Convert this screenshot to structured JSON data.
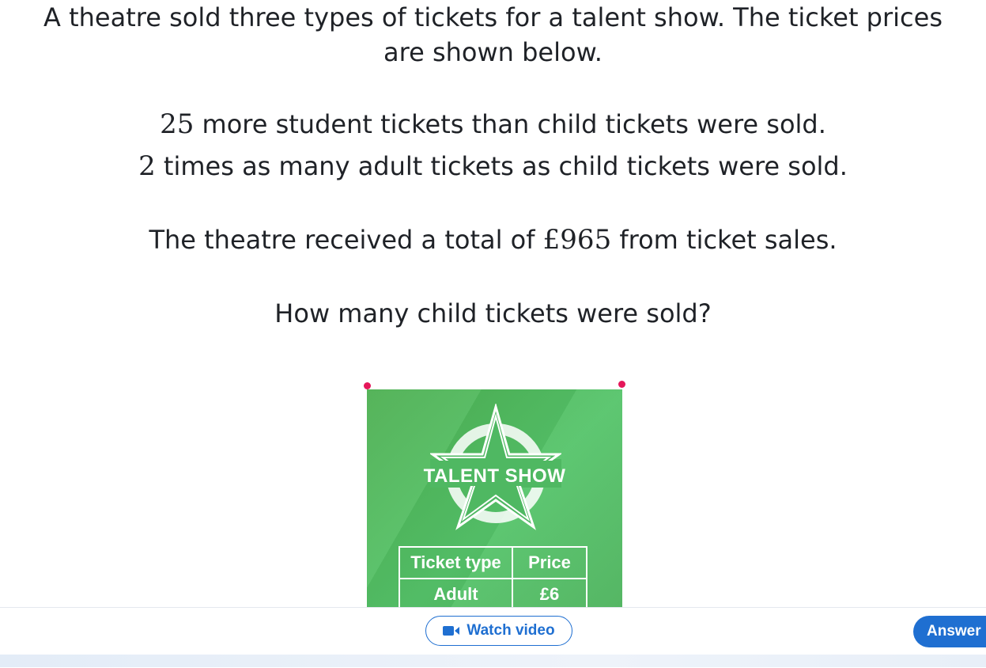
{
  "question": {
    "line1": "A theatre sold three types of tickets for a talent show. The ticket prices",
    "line2": "are shown below.",
    "line3_num": "25",
    "line3_text": " more student tickets than child tickets were sold.",
    "line4_num": "2",
    "line4_text": " times as many adult tickets as child tickets were sold.",
    "line5_pre": "The theatre received a total of ",
    "line5_amount": "£965",
    "line5_post": " from ticket sales.",
    "line6": "How many child tickets were sold?"
  },
  "poster": {
    "title": "TALENT SHOW",
    "table": {
      "headers": [
        "Ticket type",
        "Price"
      ],
      "rows": [
        [
          "Adult",
          "£6"
        ]
      ]
    }
  },
  "bottom_bar": {
    "watch_video_label": "Watch video",
    "answer_label": "Answer"
  },
  "colors": {
    "accent": "#1f6fd1",
    "poster_green": "#4caf50",
    "pin": "#e5175a"
  },
  "icons": {
    "video": "video-camera-icon",
    "star": "star-icon"
  }
}
